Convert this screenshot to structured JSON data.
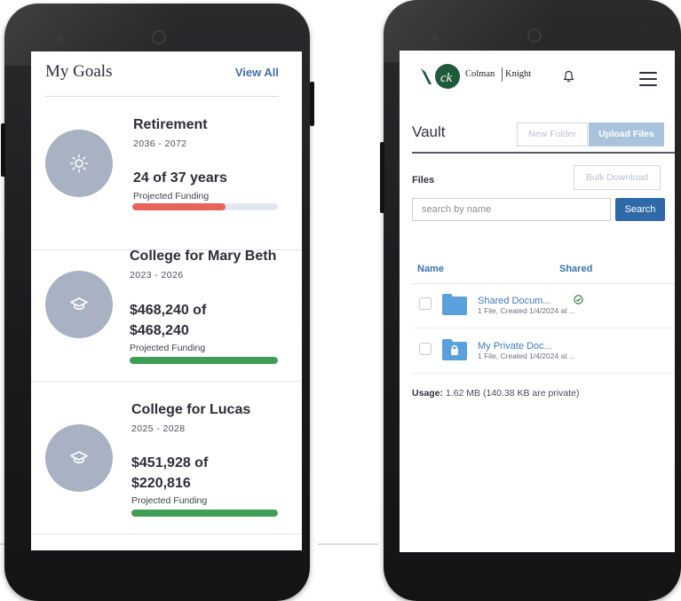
{
  "goals": {
    "title": "My Goals",
    "view_all": "View All",
    "items": [
      {
        "name": "Retirement",
        "years": "2036 - 2072",
        "amount": "24 of 37 years",
        "projected_label": "Projected Funding",
        "progress": 0.64,
        "bar_color": "#e8635a",
        "icon": "sun-icon"
      },
      {
        "name": "College for Mary Beth",
        "years": "2023 - 2026",
        "amount_line1": "$468,240 of",
        "amount_line2": "$468,240",
        "projected_label": "Projected Funding",
        "progress": 1.0,
        "bar_color": "#3f9d55",
        "icon": "graduation-cap-icon"
      },
      {
        "name": "College for Lucas",
        "years": "2025 - 2028",
        "amount_line1": "$451,928 of",
        "amount_line2": "$220,816",
        "projected_label": "Projected Funding",
        "progress": 1.0,
        "bar_color": "#3f9d55",
        "icon": "graduation-cap-icon"
      }
    ]
  },
  "vault": {
    "brand_left": "Colman",
    "brand_right": "Knight",
    "title": "Vault",
    "new_folder": "New Folder",
    "upload_files": "Upload Files",
    "files_label": "Files",
    "bulk_download": "Bulk Download",
    "search_placeholder": "search by name",
    "search_button": "Search",
    "col_name": "Name",
    "col_shared": "Shared",
    "files": [
      {
        "name": "Shared Docum...",
        "meta": "1 File, Created 1/4/2024 at ...",
        "shared": true,
        "icon": "folder-icon"
      },
      {
        "name": "My Private Doc...",
        "meta": "1 File, Created 1/4/2024 at ...",
        "shared": false,
        "icon": "locked-folder-icon"
      }
    ],
    "usage_label": "Usage:",
    "usage_value": "1.62 MB (140.38 KB are private)"
  },
  "colors": {
    "accent": "#2e6aa8",
    "link": "#3e79b8",
    "goal_circle": "#a8b2c2",
    "progress_red": "#e8635a",
    "progress_green": "#3f9d55"
  }
}
